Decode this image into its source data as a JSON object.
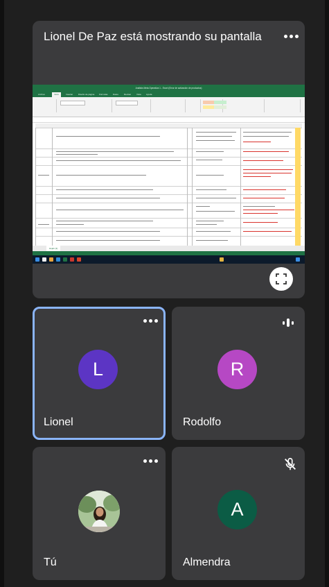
{
  "presentation": {
    "title": "Lionel De Paz está mostrando su pantalla",
    "more_icon": "more-horizontal-icon",
    "fullscreen_icon": "fullscreen-icon",
    "screen": {
      "window_title": "Análisis Meta Operativa 1 - Excel (Error de activación de productos)",
      "ribbon_tabs": [
        "Archivo",
        "Inicio",
        "Insertar",
        "Diseño de página",
        "Fórmulas",
        "Datos",
        "Revisar",
        "Vista",
        "Ayuda"
      ],
      "active_tab": "Inicio",
      "sheet_tab": "Hoja1 (2)",
      "colors": {
        "excel_green": "#1f7244",
        "taskbar": "#0c1a2b",
        "highlight_yellow": "#ffd966",
        "note_red": "#d9322c"
      }
    }
  },
  "participants": [
    {
      "name": "Lionel",
      "initial": "L",
      "avatar_color": "#5c35c4",
      "selected": true,
      "indicator": "more-horizontal-icon"
    },
    {
      "name": "Rodolfo",
      "initial": "R",
      "avatar_color": "#b648c4",
      "selected": false,
      "indicator": "speaking-indicator-icon"
    },
    {
      "name": "Tú",
      "initial": "",
      "avatar_color": "#9dbb8d",
      "selected": false,
      "indicator": "more-horizontal-icon",
      "photo": true
    },
    {
      "name": "Almendra",
      "initial": "A",
      "avatar_color": "#0b5c45",
      "selected": false,
      "indicator": "mic-off-icon"
    }
  ],
  "theme": {
    "background": "#1f1f1f",
    "tile": "#3b3b3d",
    "selected_border": "#8ab4f8"
  }
}
